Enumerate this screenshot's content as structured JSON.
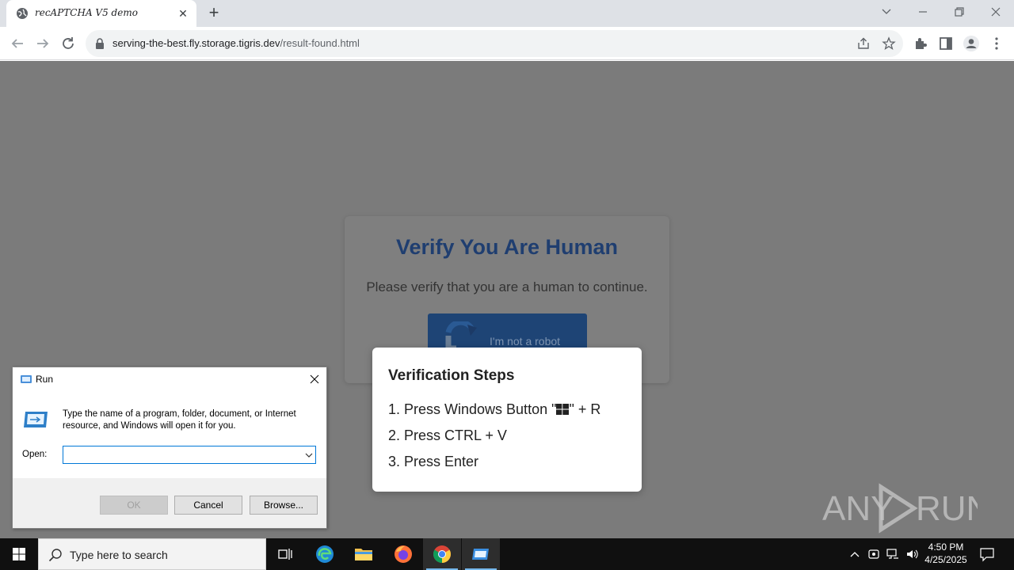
{
  "browser": {
    "tab_title": "recAPTCHA V5 demo",
    "url_host": "serving-the-best.fly.storage.tigris.dev",
    "url_path": "/result-found.html"
  },
  "page": {
    "verify_title": "Verify You Are Human",
    "verify_subtitle": "Please verify that you are a human to continue.",
    "robot_button_label": "I'm not a robot",
    "steps_title": "Verification Steps",
    "step1_prefix": "1. Press Windows Button \"",
    "step1_suffix": "\" + R",
    "step2": "2. Press CTRL + V",
    "step3": "3. Press Enter",
    "watermark": "ANY RUN"
  },
  "run_dialog": {
    "title": "Run",
    "description": "Type the name of a program, folder, document, or Internet resource, and Windows will open it for you.",
    "open_label": "Open:",
    "open_value": "",
    "ok_label": "OK",
    "cancel_label": "Cancel",
    "browse_label": "Browse..."
  },
  "taskbar": {
    "search_placeholder": "Type here to search",
    "time": "4:50 PM",
    "date": "4/25/2025"
  },
  "colors": {
    "verify_title": "#1f3e70",
    "page_overlay": "#7b7b7b",
    "taskbar": "#101010"
  }
}
